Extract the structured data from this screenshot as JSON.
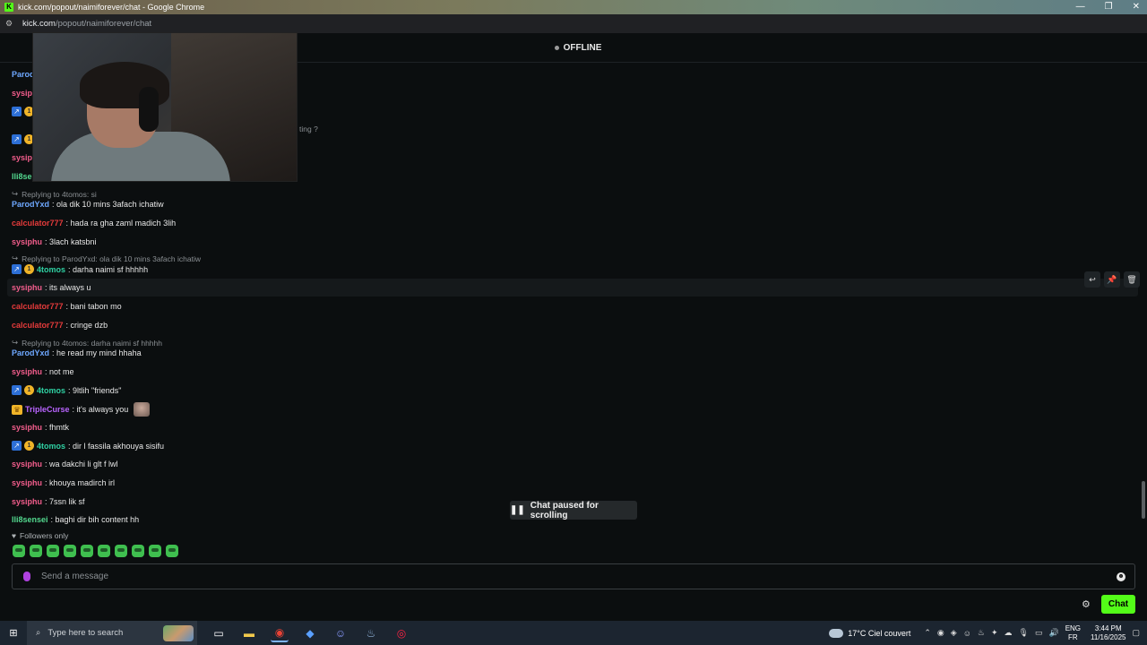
{
  "window": {
    "title": "kick.com/popout/naimiforever/chat - Google Chrome",
    "minimize": "—",
    "restore": "❐",
    "close": "✕"
  },
  "address": {
    "host": "kick.com",
    "path": "/popout/naimiforever/chat"
  },
  "header": {
    "status": "OFFLINE"
  },
  "chat": {
    "messages": [
      {
        "user": "ParodYxd",
        "text": ": ola dik 10 mins 3afach ichatiw"
      },
      {
        "user": "calculator777",
        "text": ": hada ra gha zaml madich 3lih"
      },
      {
        "user": "sysiphu",
        "text": ": 3lach katsbni"
      },
      {
        "user": "4tomos",
        "text": ": darha naimi sf hhhhh"
      },
      {
        "user": "sysiphu",
        "text": ": its always u"
      },
      {
        "user": "calculator777",
        "text": ": bani tabon mo"
      },
      {
        "user": "calculator777",
        "text": ": cringe dzb"
      },
      {
        "user": "ParodYxd",
        "text": ": he read my mind hhaha"
      },
      {
        "user": "sysiphu",
        "text": ": not me"
      },
      {
        "user": "4tomos",
        "text": ": 9ltlih \"friends\""
      },
      {
        "user": "TripleCurse",
        "text": ": it's always you"
      },
      {
        "user": "sysiphu",
        "text": ": fhmtk"
      },
      {
        "user": "4tomos",
        "text": ": dir l fassila akhouya sisifu"
      },
      {
        "user": "sysiphu",
        "text": ": wa dakchi li glt f lwl"
      },
      {
        "user": "sysiphu",
        "text": ": khouya madirch irl"
      },
      {
        "user": "sysiphu",
        "text": ": 7ssn lik sf"
      },
      {
        "user": "lli8sensei",
        "text": ": baghi dir bih content hh"
      }
    ],
    "partial": {
      "parod": "Parod",
      "sysiphu1": "sysiphu",
      "replying_tail": "ting ?",
      "sysiphu2": "sysiphu",
      "lli8se": "lli8se"
    },
    "replies": [
      "Replying to 4tomos: si",
      "Replying to ParodYxd: ola dik 10 mins 3afach ichatiw",
      "Replying to 4tomos: darha naimi sf hhhhh"
    ],
    "paused_label": "Chat paused for scrolling",
    "followers_only": "Followers only",
    "input_placeholder": "Send a message",
    "send_label": "Chat"
  },
  "taskbar": {
    "search_placeholder": "Type here to search",
    "weather": "17°C  Ciel couvert",
    "lang_top": "ENG",
    "lang_bottom": "FR",
    "time": "3:44 PM",
    "date": "11/16/2025"
  }
}
